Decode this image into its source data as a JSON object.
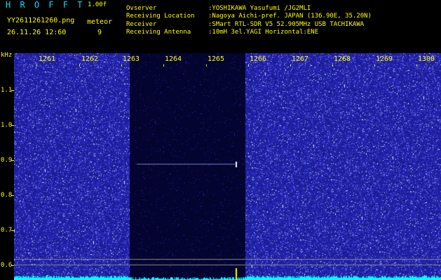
{
  "app": {
    "brand": "H R O F F T",
    "version": "1.00f",
    "filename": "YY2611261260.png",
    "timestamp": "26.11.26 12:60",
    "meteor_label": "meteor",
    "meteor_count": "9"
  },
  "info": {
    "observer_key": "Ovserver",
    "observer_val": ":YOSHIKAWA Yasufumi /JG2MLI",
    "location_key": "Receiving Location",
    "location_val": ":Nagoya Aichi-pref. JAPAN (136.90E, 35.20N)",
    "receiver_key": "Receiver",
    "receiver_val": ":SMart RTL-SDR V5 52.905MHz USB TACHIKAWA",
    "antenna_key": "Receiving Antenna",
    "antenna_val": ":10mH 3el.YAGI Horizontal:ENE"
  },
  "axis": {
    "y_unit": "kHz",
    "y_ticks": [
      "1.1",
      "1.0",
      "0.9",
      "0.8",
      "0.7",
      "0.6"
    ],
    "x_ticks": [
      "1261",
      "1262",
      "1263",
      "1264",
      "1265",
      "1266",
      "1267",
      "1268",
      "1269",
      "1300"
    ]
  },
  "colors": {
    "background": "#000000",
    "label": "#ffff00",
    "brand": "#00e0ff",
    "noise_base": "#1a1aa0",
    "noise_quiet": "#05052a",
    "level_trace": "#00ffff",
    "marker": "#ffff00"
  }
}
